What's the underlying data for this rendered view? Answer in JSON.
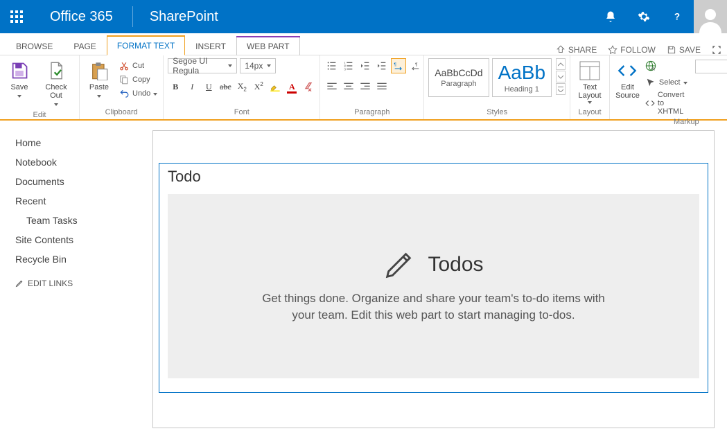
{
  "header": {
    "brand": "Office 365",
    "app": "SharePoint"
  },
  "tabs": {
    "browse": "BROWSE",
    "page": "PAGE",
    "format": "FORMAT TEXT",
    "insert": "INSERT",
    "webpart": "WEB PART"
  },
  "actions": {
    "share": "SHARE",
    "follow": "FOLLOW",
    "save": "SAVE"
  },
  "ribbon": {
    "save": "Save",
    "checkout": "Check Out",
    "paste": "Paste",
    "cut": "Cut",
    "copy": "Copy",
    "undo": "Undo",
    "font_name": "Segoe UI Regula",
    "font_size": "14px",
    "para_title": "Paragraph",
    "para_preview": "AaBbCcDd",
    "para_name": "Paragraph",
    "h1_preview": "AaBb",
    "h1_name": "Heading 1",
    "textlayout": "Text\nLayout",
    "editsource": "Edit\nSource",
    "select": "Select",
    "convert": "Convert to XHTML",
    "g_edit": "Edit",
    "g_clip": "Clipboard",
    "g_font": "Font",
    "g_para": "Paragraph",
    "g_styles": "Styles",
    "g_layout": "Layout",
    "g_markup": "Markup"
  },
  "nav": {
    "home": "Home",
    "notebook": "Notebook",
    "documents": "Documents",
    "recent": "Recent",
    "teamtasks": "Team Tasks",
    "sitecontents": "Site Contents",
    "recyclebin": "Recycle Bin",
    "editlinks": "EDIT LINKS"
  },
  "content": {
    "zone_title": "Todo",
    "todo_title": "Todos",
    "todo_desc": "Get things done. Organize and share your team's to-do items with your team. Edit this web part to start managing to-dos."
  }
}
